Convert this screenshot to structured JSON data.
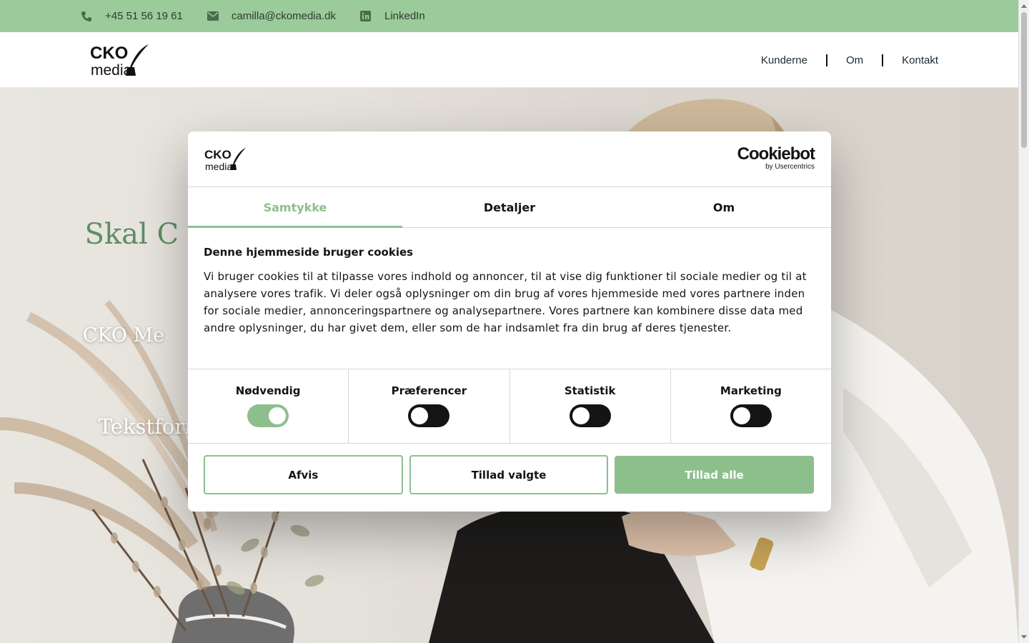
{
  "topbar": {
    "phone": "+45 51 56 19 61",
    "email": "camilla@ckomedia.dk",
    "linkedin": "LinkedIn"
  },
  "header": {
    "logo_top": "CKO",
    "logo_bottom": "media",
    "nav": [
      "Kunderne",
      "Om",
      "Kontakt"
    ]
  },
  "hero": {
    "title": "Skal C            jere",
    "sub1": "CKO Me              præcise o",
    "sub2": "Tekstform            altid"
  },
  "dialog": {
    "logo_top": "CKO",
    "logo_bottom": "media",
    "cookiebot": "Cookiebot",
    "cookiebot_by": "by Usercentrics",
    "tabs": [
      "Samtykke",
      "Detaljer",
      "Om"
    ],
    "active_tab": "Samtykke",
    "heading": "Denne hjemmeside bruger cookies",
    "body": "Vi bruger cookies til at tilpasse vores indhold og annoncer, til at vise dig funktioner til sociale medier og til at analysere vores trafik. Vi deler også oplysninger om din brug af vores hjemmeside med vores partnere inden for sociale medier, annonceringspartnere og analysepartnere. Vores partnere kan kombinere disse data med andre oplysninger, du har givet dem, eller som de har indsamlet fra din brug af deres tjenester.",
    "toggles": [
      {
        "label": "Nødvendig",
        "on": true
      },
      {
        "label": "Præferencer",
        "on": false
      },
      {
        "label": "Statistik",
        "on": false
      },
      {
        "label": "Marketing",
        "on": false
      }
    ],
    "buttons": {
      "decline": "Afvis",
      "allow_selected": "Tillad valgte",
      "allow_all": "Tillad alle"
    }
  },
  "colors": {
    "accent_green": "#8dbf8d",
    "topbar_green": "#9bca9b",
    "hero_title_green": "#5f8d64"
  },
  "icons": [
    "phone-icon",
    "envelope-icon",
    "linkedin-icon",
    "quill-icon"
  ]
}
